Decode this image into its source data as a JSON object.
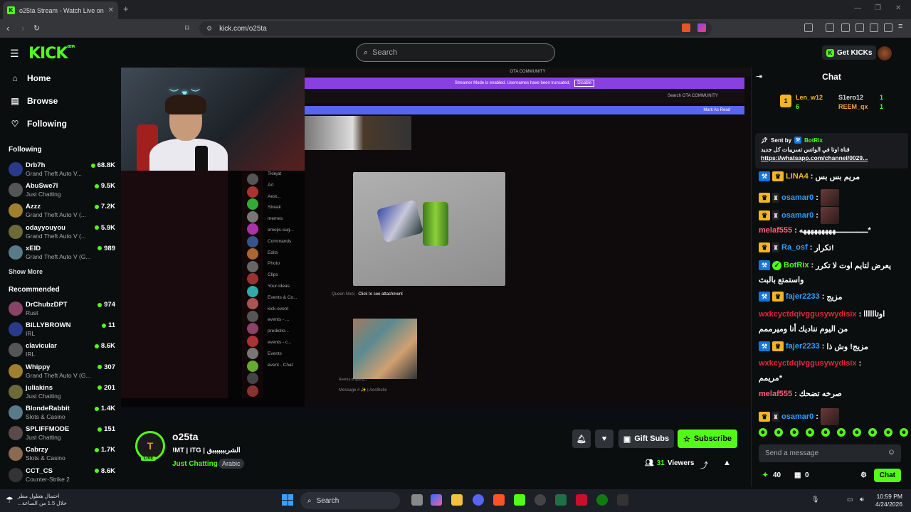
{
  "browser": {
    "tab_title": "o25ta Stream - Watch Live on Ki",
    "url": "kick.com/o25ta"
  },
  "header": {
    "logo": "KICK",
    "logo_badge": "BETA",
    "search_placeholder": "Search",
    "get_kicks": "Get KICKs"
  },
  "sidebar": {
    "nav": [
      {
        "label": "Home",
        "icon": "home-icon"
      },
      {
        "label": "Browse",
        "icon": "browse-icon"
      },
      {
        "label": "Following",
        "icon": "heart-icon"
      }
    ],
    "following_title": "Following",
    "following": [
      {
        "name": "Drb7h",
        "game": "Grand Theft Auto V...",
        "viewers": "68.8K"
      },
      {
        "name": "AbuSwe7l",
        "game": "Just Chatting",
        "viewers": "9.5K"
      },
      {
        "name": "Azzz",
        "game": "Grand Theft Auto V (...",
        "viewers": "7.2K"
      },
      {
        "name": "odayyouyou",
        "game": "Grand Theft Auto V (...",
        "viewers": "5.9K"
      },
      {
        "name": "xEID",
        "game": "Grand Theft Auto V (G...",
        "viewers": "989"
      }
    ],
    "show_more": "Show More",
    "recommended_title": "Recommended",
    "recommended": [
      {
        "name": "DrChubzDPT",
        "game": "Rust",
        "viewers": "974"
      },
      {
        "name": "BILLYBROWN",
        "game": "IRL",
        "viewers": "11"
      },
      {
        "name": "clavicular",
        "game": "IRL",
        "viewers": "8.6K"
      },
      {
        "name": "Whippy",
        "game": "Grand Theft Auto V (G...",
        "viewers": "307"
      },
      {
        "name": "juliakins",
        "game": "Just Chatting",
        "viewers": "201"
      },
      {
        "name": "BlondeRabbit",
        "game": "Slots & Casino",
        "viewers": "1.4K"
      },
      {
        "name": "SPLIFFMODE",
        "game": "Just Chatting",
        "viewers": "151"
      },
      {
        "name": "Cabrzy",
        "game": "Slots & Casino",
        "viewers": "1.7K"
      },
      {
        "name": "CCT_CS",
        "game": "Counter-Strike 2",
        "viewers": "8.6K"
      }
    ]
  },
  "video": {
    "discord_title": "OTA COMMUNITY",
    "streamer_banner": "Streamer Mode is enabled. Usernames have been truncated.",
    "disable": "Disable",
    "search_server": "Search OTA COMMUNITY",
    "mark_as_read": "Mark As Read",
    "channels": [
      "Tklejat",
      "Art",
      "Aest...",
      "Streak",
      "memes",
      "emojis-sug...",
      "Commands",
      "Edits",
      "Photo",
      "Clips",
      "Your-ideas",
      "Events & Co...",
      "kick-event",
      "events - ...",
      "predictio...",
      "events - c...",
      "Events",
      "event - Chat"
    ],
    "click_attachment": "Click to see attachment",
    "author": "Queen Noni",
    "message_placeholder": "Message # ✨ | Aesthetic",
    "typing": "Reema is typing..."
  },
  "channel": {
    "name": "o25ta",
    "title": "!MT | ITG | الشربببببببق",
    "category": "Just Chatting",
    "tag": "Arabic",
    "live": "LIVE",
    "gift_subs": "Gift Subs",
    "subscribe": "Subscribe",
    "viewers": "31",
    "viewers_label": "Viewers"
  },
  "chat": {
    "title": "Chat",
    "leaders": [
      {
        "name": "Len_w12",
        "count": "6"
      },
      {
        "name": "S1ero12",
        "count": "1"
      },
      {
        "name": "REEM_qx",
        "count": "1"
      }
    ],
    "pinned": {
      "sent_by": "Sent by",
      "user": "BotRix",
      "text": "قناة اوتا في الواتس تسريبات كل جديد",
      "link": "https://whatsapp.com/channel/0029..."
    },
    "messages": [
      {
        "user": "LINA4",
        "color": "#f3b520",
        "badges": [
          "mod",
          "crown"
        ],
        "text": "مريم بس بس"
      },
      {
        "user": "osamar0",
        "color": "#2f9fff",
        "badges": [
          "crown",
          "sub"
        ],
        "text": ""
      },
      {
        "user": "osamar0",
        "color": "#2f9fff",
        "badges": [
          "crown",
          "sub"
        ],
        "text": ""
      },
      {
        "user": "melaf555",
        "color": "#ff5f7a",
        "badges": [],
        "text": "ــــــــــــــهههههههههه*"
      },
      {
        "user": "Ra_osf",
        "color": "#2f9fff",
        "badges": [
          "crown",
          "sub"
        ],
        "text": "تكرار!"
      },
      {
        "user": "BotRix",
        "color": "#53fc18",
        "badges": [
          "mod",
          "ver"
        ],
        "text": "يعرض لتايم اوت لا تكرر"
      },
      {
        "user": "",
        "color": "#fff",
        "badges": [],
        "text": "واستمتع بالبث"
      },
      {
        "user": "fajer2233",
        "color": "#2f9fff",
        "badges": [
          "mod",
          "crown"
        ],
        "text": "مزيج"
      },
      {
        "user": "wxkcyctdqivggusywydisix",
        "color": "#e0263a",
        "badges": [],
        "text": "اوتاااااا"
      },
      {
        "user": "",
        "color": "#fff",
        "badges": [],
        "text": "من اليوم نناديك أنا وميرممم"
      },
      {
        "user": "fajer2233",
        "color": "#2f9fff",
        "badges": [
          "mod",
          "crown"
        ],
        "text": "مزيج! وش ذا"
      },
      {
        "user": "wxkcyctdqivggusywydisix",
        "color": "#e0263a",
        "badges": [],
        "text": ""
      },
      {
        "user": "",
        "color": "#fff",
        "badges": [],
        "text": "مريمم*"
      },
      {
        "user": "melaf555",
        "color": "#ff5f7a",
        "badges": [],
        "text": "صرخه تضحك"
      },
      {
        "user": "osamar0",
        "color": "#2f9fff",
        "badges": [
          "crown",
          "sub"
        ],
        "text": ""
      }
    ],
    "input_placeholder": "Send a message",
    "kicks": "40",
    "cart": "0",
    "chat_button": "Chat"
  },
  "taskbar": {
    "weather_line1": "احتمال هطول مطر",
    "weather_line2": "خلال 1.5 من الساعة...",
    "search": "Search",
    "time": "10:59 PM",
    "date": "4/24/2026"
  },
  "colors": {
    "accent": "#53fc18",
    "bg": "#0b0e0f",
    "crown": "#f3b520",
    "mod": "#1475e1"
  }
}
